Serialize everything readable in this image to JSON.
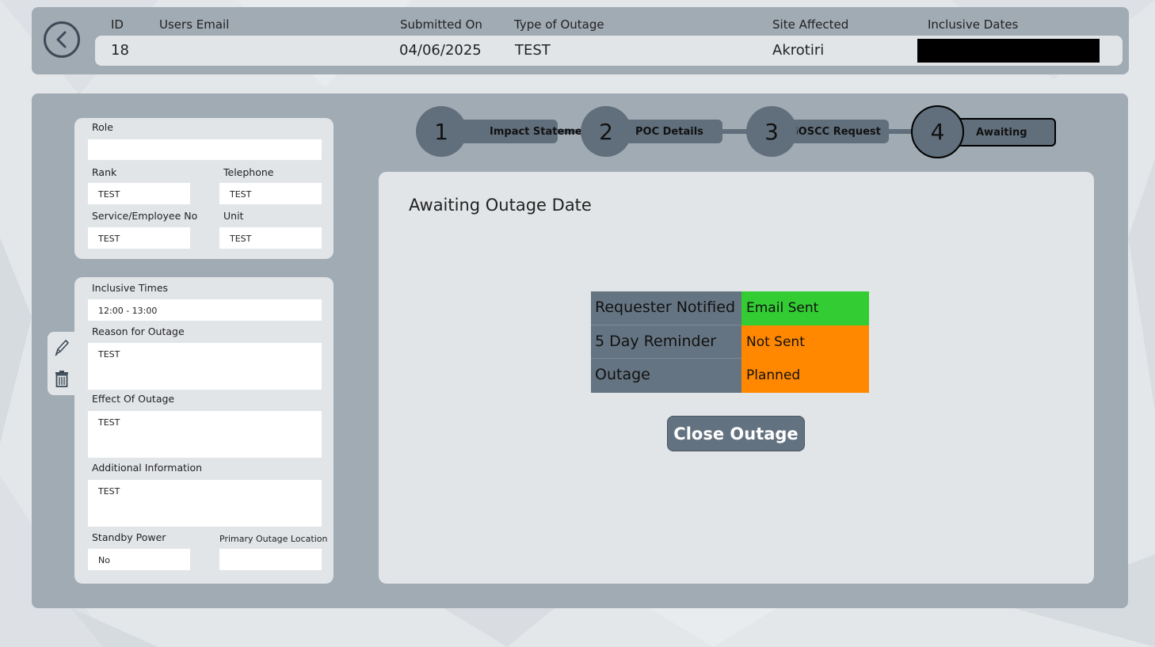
{
  "header": {
    "columns": {
      "id": "ID",
      "email": "Users Email",
      "submitted": "Submitted On",
      "type": "Type of Outage",
      "site": "Site Affected",
      "dates": "Inclusive Dates"
    },
    "record": {
      "id": "18",
      "email": "",
      "submitted": "04/06/2025",
      "type": "TEST",
      "site": "Akrotiri"
    }
  },
  "details": {
    "role_label": "Role",
    "role_value": "",
    "rank_label": "Rank",
    "rank_value": "TEST",
    "telephone_label": "Telephone",
    "telephone_value": "TEST",
    "service_label": "Service/Employee No",
    "service_value": "TEST",
    "unit_label": "Unit",
    "unit_value": "TEST"
  },
  "outage": {
    "times_label": "Inclusive Times",
    "times_value": "12:00 - 13:00",
    "reason_label": "Reason for Outage",
    "reason_value": "TEST",
    "effect_label": "Effect Of Outage",
    "effect_value": "TEST",
    "additional_label": "Additional Information",
    "additional_value": "TEST",
    "standby_label": "Standby Power",
    "standby_value": "No",
    "location_label": "Primary Outage Location",
    "location_value": ""
  },
  "steps": [
    {
      "number": "1",
      "label": "Impact Statement"
    },
    {
      "number": "2",
      "label": "POC Details"
    },
    {
      "number": "3",
      "label": "GOSCC Request"
    },
    {
      "number": "4",
      "label": "Awaiting"
    }
  ],
  "panel": {
    "title": "Awaiting Outage Date",
    "status": [
      {
        "key": "Requester Notified",
        "value": "Email Sent",
        "color": "#33cc33"
      },
      {
        "key": "5 Day Reminder",
        "value": "Not Sent",
        "color": "#ff8800"
      },
      {
        "key": "Outage",
        "value": "Planned",
        "color": "#ff8800"
      }
    ],
    "close_label": "Close Outage"
  },
  "icons": {
    "back": "chevron-left-icon",
    "edit": "pencil-icon",
    "delete": "trash-icon"
  }
}
